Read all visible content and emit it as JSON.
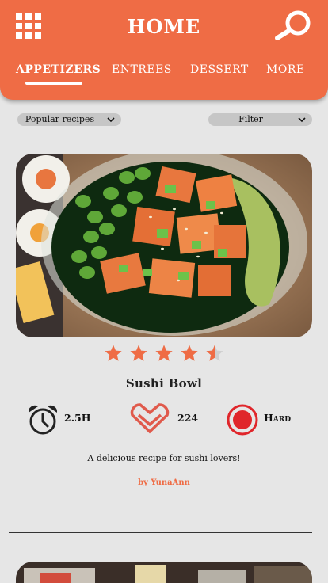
{
  "header": {
    "title": "HOME",
    "menu_icon": "grid-menu-icon",
    "search_icon": "search-icon",
    "tabs": [
      {
        "label": "APPETIZERS",
        "active": true
      },
      {
        "label": "ENTREES",
        "active": false
      },
      {
        "label": "DESSERT",
        "active": false
      },
      {
        "label": "MORE",
        "active": false
      }
    ]
  },
  "controls": {
    "sort": {
      "selected": "Popular recipes"
    },
    "filter": {
      "selected": "Filter"
    }
  },
  "recipe": {
    "name": "Sushi Bowl",
    "rating": 4.5,
    "rating_max": 5,
    "time": "2.5H",
    "likes": "224",
    "difficulty": "Hard",
    "description": "A delicious recipe for sushi lovers!",
    "author": "by YunaAnn"
  },
  "colors": {
    "accent": "#ef6c45",
    "background": "#e6e6e6",
    "star": "#ef6c45",
    "heart": "#e05a4c",
    "difficulty": "#e0262b"
  }
}
